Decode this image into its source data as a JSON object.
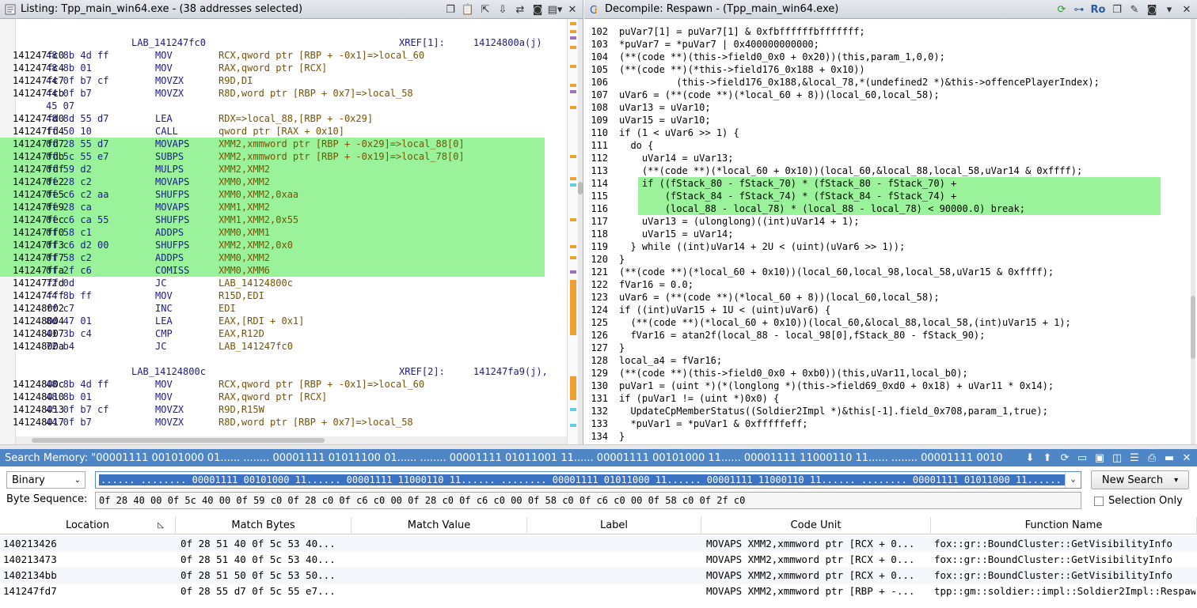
{
  "listing": {
    "title": "Listing:  Tpp_main_win64.exe - (38 addresses selected)",
    "rows": [
      {
        "type": "label",
        "label": "LAB_141247fc0",
        "xref": "XREF[1]:     14124800a(j)"
      },
      {
        "type": "ins",
        "addr": "141247fc0",
        "bytes": "48 8b 4d ff",
        "mn": "MOV",
        "op": "RCX,qword ptr [RBP + -0x1]=>local_60",
        "hl": false
      },
      {
        "type": "ins",
        "addr": "141247fc4",
        "bytes": "48 8b 01",
        "mn": "MOV",
        "op": "RAX,qword ptr [RCX]",
        "hl": false
      },
      {
        "type": "ins",
        "addr": "141247fc7",
        "bytes": "44 0f b7 cf",
        "mn": "MOVZX",
        "op": "R9D,DI",
        "hl": false
      },
      {
        "type": "ins",
        "addr": "141247fcb",
        "bytes": "44 0f b7",
        "mn": "MOVZX",
        "op": "R8D,word ptr [RBP + 0x7]=>local_58",
        "hl": false
      },
      {
        "type": "ins",
        "addr": "",
        "bytes": "45 07",
        "mn": "",
        "op": "",
        "hl": false
      },
      {
        "type": "ins",
        "addr": "141247fd0",
        "bytes": "48 8d 55 d7",
        "mn": "LEA",
        "op": "RDX=>local_88,[RBP + -0x29]",
        "hl": false
      },
      {
        "type": "ins",
        "addr": "141247fd4",
        "bytes": "ff 50 10",
        "mn": "CALL",
        "op": "qword ptr [RAX + 0x10]",
        "hl": false
      },
      {
        "type": "ins",
        "addr": "141247fd7",
        "bytes": "0f 28 55 d7",
        "mn": "MOVAPS",
        "op": "XMM2,xmmword ptr [RBP + -0x29]=>local_88[0]",
        "hl": true
      },
      {
        "type": "ins",
        "addr": "141247fdb",
        "bytes": "0f 5c 55 e7",
        "mn": "SUBPS",
        "op": "XMM2,xmmword ptr [RBP + -0x19]=>local_78[0]",
        "hl": true
      },
      {
        "type": "ins",
        "addr": "141247fdf",
        "bytes": "0f 59 d2",
        "mn": "MULPS",
        "op": "XMM2,XMM2",
        "hl": true
      },
      {
        "type": "ins",
        "addr": "141247fe2",
        "bytes": "0f 28 c2",
        "mn": "MOVAPS",
        "op": "XMM0,XMM2",
        "hl": true
      },
      {
        "type": "ins",
        "addr": "141247fe5",
        "bytes": "0f c6 c2 aa",
        "mn": "SHUFPS",
        "op": "XMM0,XMM2,0xaa",
        "hl": true
      },
      {
        "type": "ins",
        "addr": "141247fe9",
        "bytes": "0f 28 ca",
        "mn": "MOVAPS",
        "op": "XMM1,XMM2",
        "hl": true
      },
      {
        "type": "ins",
        "addr": "141247fec",
        "bytes": "0f c6 ca 55",
        "mn": "SHUFPS",
        "op": "XMM1,XMM2,0x55",
        "hl": true
      },
      {
        "type": "ins",
        "addr": "141247ff0",
        "bytes": "0f 58 c1",
        "mn": "ADDPS",
        "op": "XMM0,XMM1",
        "hl": true
      },
      {
        "type": "ins",
        "addr": "141247ff3",
        "bytes": "0f c6 d2 00",
        "mn": "SHUFPS",
        "op": "XMM2,XMM2,0x0",
        "hl": true
      },
      {
        "type": "ins",
        "addr": "141247ff7",
        "bytes": "0f 58 c2",
        "mn": "ADDPS",
        "op": "XMM0,XMM2",
        "hl": true
      },
      {
        "type": "ins",
        "addr": "141247ffa",
        "bytes": "0f 2f c6",
        "mn": "COMISS",
        "op": "XMM0,XMM6",
        "hl": true
      },
      {
        "type": "ins",
        "addr": "141247ffd",
        "bytes": "72 0d",
        "mn": "JC",
        "op": "LAB_14124800c",
        "hl": false
      },
      {
        "type": "ins",
        "addr": "141247fff",
        "bytes": "44 8b ff",
        "mn": "MOV",
        "op": "R15D,EDI",
        "hl": false
      },
      {
        "type": "ins",
        "addr": "141248002",
        "bytes": "ff c7",
        "mn": "INC",
        "op": "EDI",
        "hl": false
      },
      {
        "type": "ins",
        "addr": "141248004",
        "bytes": "8d 47 01",
        "mn": "LEA",
        "op": "EAX,[RDI + 0x1]",
        "hl": false
      },
      {
        "type": "ins",
        "addr": "141248007",
        "bytes": "41 3b c4",
        "mn": "CMP",
        "op": "EAX,R12D",
        "hl": false
      },
      {
        "type": "ins",
        "addr": "14124800a",
        "bytes": "72 b4",
        "mn": "JC",
        "op": "LAB_141247fc0",
        "hl": false
      },
      {
        "type": "blank"
      },
      {
        "type": "label",
        "label": "LAB_14124800c",
        "xref": "XREF[2]:     141247fa9(j),"
      },
      {
        "type": "ins",
        "addr": "14124800c",
        "bytes": "48 8b 4d ff",
        "mn": "MOV",
        "op": "RCX,qword ptr [RBP + -0x1]=>local_60",
        "hl": false
      },
      {
        "type": "ins",
        "addr": "141248010",
        "bytes": "48 8b 01",
        "mn": "MOV",
        "op": "RAX,qword ptr [RCX]",
        "hl": false
      },
      {
        "type": "ins",
        "addr": "141248013",
        "bytes": "45 0f b7 cf",
        "mn": "MOVZX",
        "op": "R9D,R15W",
        "hl": false
      },
      {
        "type": "ins",
        "addr": "141248017",
        "bytes": "44 0f b7",
        "mn": "MOVZX",
        "op": "R8D,word ptr [RBP + 0x7]=>local_58",
        "hl": false
      }
    ]
  },
  "decompile": {
    "title": "Decompile: Respawn -  (Tpp_main_win64.exe)",
    "lines": [
      {
        "n": "102",
        "t": "puVar7[1] = puVar7[1] & 0xfbffffffbfffffff;"
      },
      {
        "n": "103",
        "t": "*puVar7 = *puVar7 | 0x400000000000;"
      },
      {
        "n": "104",
        "t": "(**(code **)(this->field0_0x0 + 0x20))(this,param_1,0,0);"
      },
      {
        "n": "105",
        "t": "(**(code **)(*this->field176_0x188 + 0x10))"
      },
      {
        "n": "106",
        "t": "          (this->field176_0x188,&local_78,*(undefined2 *)&this->offencePlayerIndex);"
      },
      {
        "n": "107",
        "t": "uVar6 = (**(code **)(*local_60 + 8))(local_60,local_58);"
      },
      {
        "n": "108",
        "t": "uVar13 = uVar10;"
      },
      {
        "n": "109",
        "t": "uVar15 = uVar10;"
      },
      {
        "n": "110",
        "t": "if (1 < uVar6 >> 1) {"
      },
      {
        "n": "111",
        "t": "  do {"
      },
      {
        "n": "112",
        "t": "    uVar14 = uVar13;"
      },
      {
        "n": "113",
        "t": "    (**(code **)(*local_60 + 0x10))(local_60,&local_88,local_58,uVar14 & 0xffff);"
      },
      {
        "n": "114",
        "t": "    if ((fStack_80 - fStack_70) * (fStack_80 - fStack_70) +"
      },
      {
        "n": "115",
        "t": "        (fStack_84 - fStack_74) * (fStack_84 - fStack_74) +"
      },
      {
        "n": "116",
        "t": "        (local_88 - local_78) * (local_88 - local_78) < 90000.0) break;"
      },
      {
        "n": "117",
        "t": "    uVar13 = (ulonglong)((int)uVar14 + 1);"
      },
      {
        "n": "118",
        "t": "    uVar15 = uVar14;"
      },
      {
        "n": "119",
        "t": "  } while ((int)uVar14 + 2U < (uint)(uVar6 >> 1));"
      },
      {
        "n": "120",
        "t": "}"
      },
      {
        "n": "121",
        "t": "(**(code **)(*local_60 + 0x10))(local_60,local_98,local_58,uVar15 & 0xffff);"
      },
      {
        "n": "122",
        "t": "fVar16 = 0.0;"
      },
      {
        "n": "123",
        "t": "uVar6 = (**(code **)(*local_60 + 8))(local_60,local_58);"
      },
      {
        "n": "124",
        "t": "if ((int)uVar15 + 1U < (uint)uVar6) {"
      },
      {
        "n": "125",
        "t": "  (**(code **)(*local_60 + 0x10))(local_60,&local_88,local_58,(int)uVar15 + 1);"
      },
      {
        "n": "126",
        "t": "  fVar16 = atan2f(local_88 - local_98[0],fStack_80 - fStack_90);"
      },
      {
        "n": "127",
        "t": "}"
      },
      {
        "n": "128",
        "t": "local_a4 = fVar16;"
      },
      {
        "n": "129",
        "t": "(**(code **)(this->field0_0x0 + 0xb0))(this,uVar11,local_b0);"
      },
      {
        "n": "130",
        "t": "puVar1 = (uint *)(*(longlong *)(this->field69_0xd0 + 0x18) + uVar11 * 0x14);"
      },
      {
        "n": "131",
        "t": "if (puVar1 != (uint *)0x0) {"
      },
      {
        "n": "132",
        "t": "  UpdateCpMemberStatus((Soldier2Impl *)&this[-1].field_0x708,param_1,true);"
      },
      {
        "n": "133",
        "t": "  *puVar1 = *puVar1 & 0xfffffeff;"
      },
      {
        "n": "134",
        "t": "}"
      }
    ],
    "ro_label": "Ro"
  },
  "search": {
    "title": "Search Memory: \"00001111 00101000 01...... ........ 00001111 01011100 01...... ........ 00001111 01011001 11...... 00001111 00101000 11...... 00001111 11000110 11...... ........ 00001111 0010100...",
    "format": "Binary",
    "query": "...... ........ 00001111 00101000 11...... 00001111 11000110 11...... ........ 00001111 01011000 11...... 00001111 11000110 11...... ........ 00001111 01011000 11...... 00001111 00101111 11......",
    "byte_seq_label": "Byte Sequence:",
    "byte_seq": "0f 28 40 00 0f 5c 40 00 0f 59 c0 0f 28 c0 0f c6 c0 00 0f 28 c0 0f c6 c0 00 0f 58 c0 0f c6 c0 00 0f 58 c0 0f 2f c0",
    "new_search": "New Search",
    "selection_only": "Selection Only",
    "columns": [
      "Location",
      "Match Bytes",
      "Match Value",
      "Label",
      "Code Unit",
      "Function Name"
    ],
    "rows": [
      {
        "loc": "140213426",
        "bytes": "0f 28 51 40 0f 5c 53 40...",
        "val": "",
        "label": "",
        "code": "MOVAPS XMM2,xmmword ptr [RCX + 0...",
        "fn": "fox::gr::BoundCluster::GetVisibilityInfo"
      },
      {
        "loc": "140213473",
        "bytes": "0f 28 51 40 0f 5c 53 40...",
        "val": "",
        "label": "",
        "code": "MOVAPS XMM2,xmmword ptr [RCX + 0...",
        "fn": "fox::gr::BoundCluster::GetVisibilityInfo"
      },
      {
        "loc": "1402134bb",
        "bytes": "0f 28 51 50 0f 5c 53 50...",
        "val": "",
        "label": "",
        "code": "MOVAPS XMM2,xmmword ptr [RCX + 0...",
        "fn": "fox::gr::BoundCluster::GetVisibilityInfo"
      },
      {
        "loc": "141247fd7",
        "bytes": "0f 28 55 d7 0f 5c 55 e7...",
        "val": "",
        "label": "",
        "code": "MOVAPS XMM2,xmmword ptr [RBP + -...",
        "fn": "tpp::gm::soldier::impl::Soldier2Impl::Respawn"
      }
    ]
  }
}
